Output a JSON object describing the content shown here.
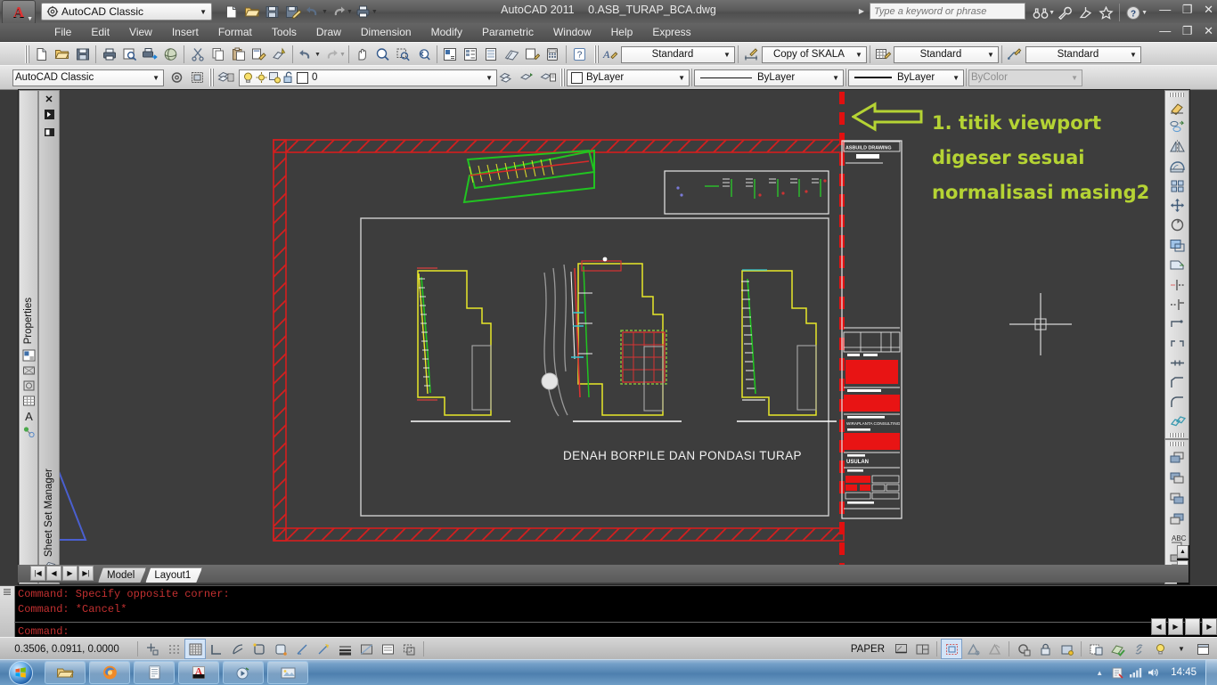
{
  "titlebar": {
    "workspace": "AutoCAD Classic",
    "app_title": "AutoCAD 2011",
    "document_title": "0.ASB_TURAP_BCA.dwg",
    "search_placeholder": "Type a keyword or phrase",
    "minimize": "—",
    "maximize": "❐",
    "close": "✕",
    "quick_icons": [
      "new-icon",
      "open-icon",
      "save-icon",
      "saveas-icon",
      "undo-icon",
      "redo-icon",
      "plot-icon"
    ],
    "right_icons": [
      "binoculars-icon",
      "wrench-icon",
      "satellite-icon",
      "star-icon",
      "help-icon"
    ]
  },
  "menubar": {
    "items": [
      {
        "label": "File"
      },
      {
        "label": "Edit"
      },
      {
        "label": "View"
      },
      {
        "label": "Insert"
      },
      {
        "label": "Format"
      },
      {
        "label": "Tools"
      },
      {
        "label": "Draw"
      },
      {
        "label": "Dimension"
      },
      {
        "label": "Modify"
      },
      {
        "label": "Parametric"
      },
      {
        "label": "Window"
      },
      {
        "label": "Help"
      },
      {
        "label": "Express"
      }
    ]
  },
  "toolbars": {
    "text_style": "Standard",
    "dim_style": "Copy of SKALA",
    "table_style": "Standard",
    "mleader_style": "Standard",
    "workspace_combo": "AutoCAD Classic",
    "layer_name": "0",
    "color_value": "ByLayer",
    "linetype_value": "ByLayer",
    "lineweight_value": "ByLayer",
    "plotstyle_value": "ByColor"
  },
  "panels": {
    "properties": "Properties",
    "sheet_set_manager": "Sheet Set Manager"
  },
  "canvas": {
    "annotation_lines": [
      "1. titik viewport",
      "digeser sesuai",
      "normalisasi masing2"
    ],
    "drawing_title": "DENAH BORPILE DAN PONDASI TURAP",
    "titleblock_header": "ASBUILD DRAWING",
    "titleblock_consultant": "WIRAPLANTA CONSULTING",
    "titleblock_label": "USULAN"
  },
  "layout_tabs": {
    "nav": [
      "|◀",
      "◀",
      "▶",
      "▶|"
    ],
    "tabs": [
      {
        "label": "Model",
        "active": false
      },
      {
        "label": "Layout1",
        "active": true
      }
    ]
  },
  "command_window": {
    "history": "Command: Specify opposite corner:\nCommand: *Cancel*",
    "prompt": "Command:"
  },
  "statusbar": {
    "coordinates": "0.3506, 0.0911, 0.0000",
    "space_label": "PAPER",
    "toggles": [
      "snap-icon",
      "grid-display-icon",
      "grid-icon",
      "ortho-icon",
      "polar-icon",
      "osnap-icon",
      "otrack-icon",
      "ducs-icon",
      "dyn-icon"
    ]
  },
  "taskbar": {
    "clock": "14:45",
    "buttons": [
      "explorer-icon",
      "firefox-icon",
      "notepad-icon",
      "acrobat-icon",
      "media-icon",
      "picture-icon"
    ],
    "tray": [
      "show-hidden-icon",
      "action-center-icon",
      "network-icon",
      "volume-icon"
    ]
  },
  "colors": {
    "canvas_bg": "#3d3d3d",
    "annotation": "#b5d334",
    "viewport_border": "#d41f1f",
    "command_text": "#c23030",
    "accent_yellow": "#e8e82a",
    "accent_green": "#21c421"
  }
}
